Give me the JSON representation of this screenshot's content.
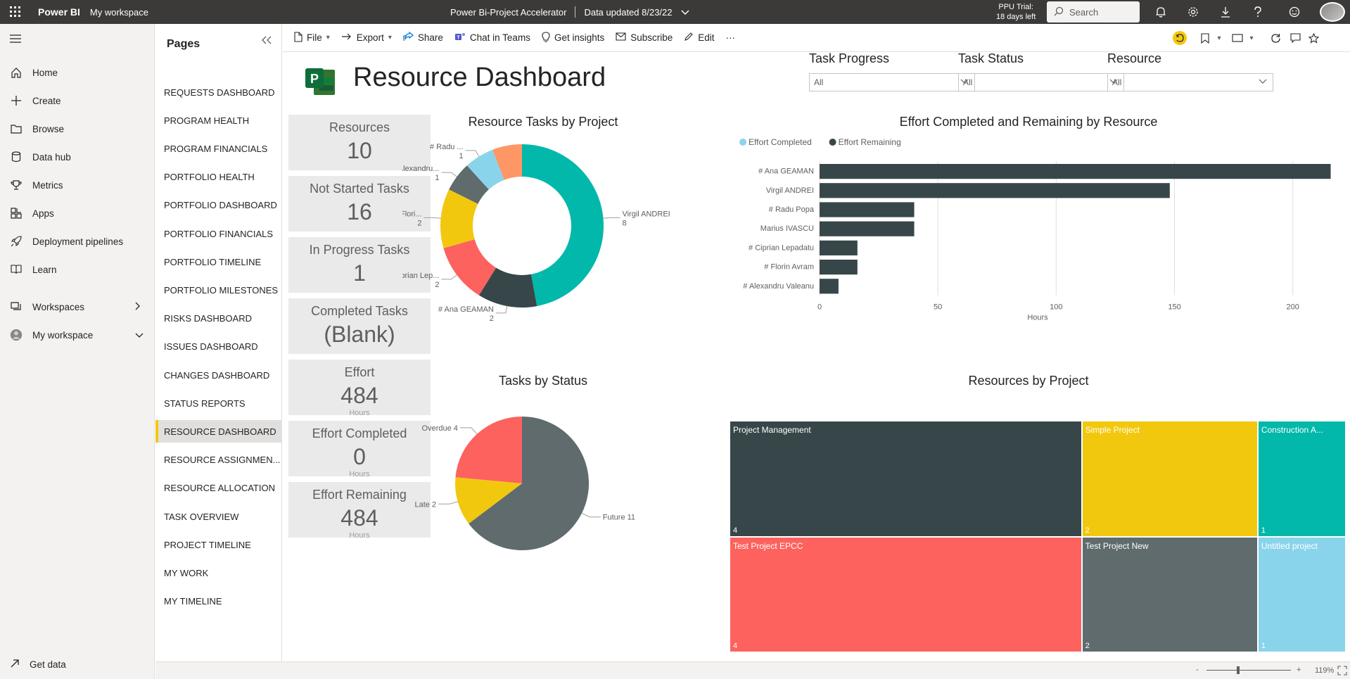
{
  "topbar": {
    "brand": "Power BI",
    "workspace": "My workspace",
    "report_title": "Power Bi-Project Accelerator",
    "data_updated": "Data updated 8/23/22",
    "trial_line1": "PPU Trial:",
    "trial_line2": "18 days left",
    "search_placeholder": "Search"
  },
  "leftnav": {
    "items": [
      {
        "label": "Home",
        "icon": "home-icon"
      },
      {
        "label": "Create",
        "icon": "plus-icon"
      },
      {
        "label": "Browse",
        "icon": "folder-icon"
      },
      {
        "label": "Data hub",
        "icon": "database-icon"
      },
      {
        "label": "Metrics",
        "icon": "trophy-icon"
      },
      {
        "label": "Apps",
        "icon": "apps-icon"
      },
      {
        "label": "Deployment pipelines",
        "icon": "rocket-icon"
      },
      {
        "label": "Learn",
        "icon": "book-icon"
      },
      {
        "label": "Workspaces",
        "icon": "workspaces-icon"
      },
      {
        "label": "My workspace",
        "icon": "avatar-icon"
      }
    ],
    "get_data": "Get data"
  },
  "pages": {
    "title": "Pages",
    "items": [
      "REQUESTS DASHBOARD",
      "PROGRAM HEALTH",
      "PROGRAM FINANCIALS",
      "PORTFOLIO HEALTH",
      "PORTFOLIO DASHBOARD",
      "PORTFOLIO FINANCIALS",
      "PORTFOLIO TIMELINE",
      "PORTFOLIO MILESTONES",
      "RISKS DASHBOARD",
      "ISSUES DASHBOARD",
      "CHANGES DASHBOARD",
      "STATUS REPORTS",
      "RESOURCE DASHBOARD",
      "RESOURCE ASSIGNMEN...",
      "RESOURCE ALLOCATION",
      "TASK OVERVIEW",
      "PROJECT TIMELINE",
      "MY WORK",
      "MY TIMELINE"
    ],
    "active_index": 12
  },
  "toolbar": {
    "file": "File",
    "export": "Export",
    "share": "Share",
    "chat_in_teams": "Chat in Teams",
    "get_insights": "Get insights",
    "subscribe": "Subscribe",
    "edit": "Edit",
    "more": "···"
  },
  "report": {
    "title": "Resource Dashboard",
    "slicers": [
      {
        "title": "Task Progress",
        "value": "All"
      },
      {
        "title": "Task Status",
        "value": "All"
      },
      {
        "title": "Resource",
        "value": "All"
      }
    ],
    "kpis": [
      {
        "label": "Resources",
        "value": "10",
        "unit": ""
      },
      {
        "label": "Not Started Tasks",
        "value": "16",
        "unit": ""
      },
      {
        "label": "In Progress Tasks",
        "value": "1",
        "unit": ""
      },
      {
        "label": "Completed Tasks",
        "value": "(Blank)",
        "unit": ""
      },
      {
        "label": "Effort",
        "value": "484",
        "unit": "Hours"
      },
      {
        "label": "Effort Completed",
        "value": "0",
        "unit": "Hours"
      },
      {
        "label": "Effort Remaining",
        "value": "484",
        "unit": "Hours"
      }
    ]
  },
  "colors": {
    "teal": "#01b8aa",
    "dark": "#374649",
    "red": "#fd625e",
    "yellow": "#f2c80f",
    "gray": "#5f6b6d",
    "lightblue": "#8ad4eb",
    "orange": "#fe9666",
    "accent": "#f2c811"
  },
  "chart_data": [
    {
      "type": "pie",
      "variant": "donut",
      "title": "Resource Tasks by Project",
      "categories": [
        "Virgil ANDREI",
        "# Ana GEAMAN",
        "# Ciprian Lep...",
        "# Flori...",
        "# Alexandru...",
        "# Radu ...",
        ""
      ],
      "values": [
        8,
        2,
        2,
        2,
        1,
        1,
        1
      ],
      "colors": [
        "#01b8aa",
        "#374649",
        "#fd625e",
        "#f2c80f",
        "#5f6b6d",
        "#8ad4eb",
        "#fe9666"
      ]
    },
    {
      "type": "bar",
      "orientation": "horizontal",
      "title": "Effort Completed and Remaining by Resource",
      "legend": [
        "Effort Completed",
        "Effort Remaining"
      ],
      "legend_colors": [
        "#8ad4eb",
        "#374649"
      ],
      "legend_position": "top-left",
      "categories": [
        "# Ana GEAMAN",
        "Virgil ANDREI",
        "# Radu Popa",
        "Marius IVASCU",
        "# Ciprian Lepadatu",
        "# Florin Avram",
        "# Alexandru Valeanu"
      ],
      "series": [
        {
          "name": "Effort Completed",
          "values": [
            0,
            0,
            0,
            0,
            0,
            0,
            0
          ]
        },
        {
          "name": "Effort Remaining",
          "values": [
            216,
            148,
            40,
            40,
            16,
            16,
            8
          ]
        }
      ],
      "xlabel": "Hours",
      "xticks": [
        0,
        50,
        100,
        150,
        200
      ],
      "xlim": [
        0,
        220
      ],
      "grid": true
    },
    {
      "type": "pie",
      "title": "Tasks by Status",
      "categories": [
        "Future",
        "Late",
        "Overdue"
      ],
      "values": [
        11,
        2,
        4
      ],
      "colors": [
        "#5f6b6d",
        "#f2c80f",
        "#fd625e"
      ]
    },
    {
      "type": "treemap",
      "title": "Resources by Project",
      "categories": [
        "Project Management",
        "Test Project EPCC",
        "Simple Project",
        "Test Project New",
        "Construction A...",
        "Untitled project"
      ],
      "values": [
        4,
        4,
        2,
        2,
        1,
        1
      ],
      "colors": [
        "#374649",
        "#fd625e",
        "#f2c80f",
        "#5f6b6d",
        "#01b8aa",
        "#8ad4eb"
      ]
    }
  ],
  "statusbar": {
    "zoom": "119%",
    "minus": "-",
    "plus": "+"
  }
}
